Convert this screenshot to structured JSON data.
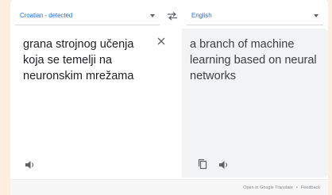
{
  "source": {
    "language_label": "Croatian - detected",
    "text": "grana strojnog učenja koja se temelji na neuronskim mrežama"
  },
  "target": {
    "language_label": "English",
    "text": "a branch of machine learning based on neural networks"
  },
  "footer": {
    "open_link": "Open in Google Translate",
    "separator": "•",
    "feedback_link": "Feedback"
  },
  "colors": {
    "page_background": "#fdeee0",
    "accent": "#1a73e8",
    "target_panel": "#f1f3f4"
  },
  "icons": [
    "chevron-down-icon",
    "swap-languages-icon",
    "clear-icon",
    "speaker-icon",
    "copy-icon"
  ]
}
